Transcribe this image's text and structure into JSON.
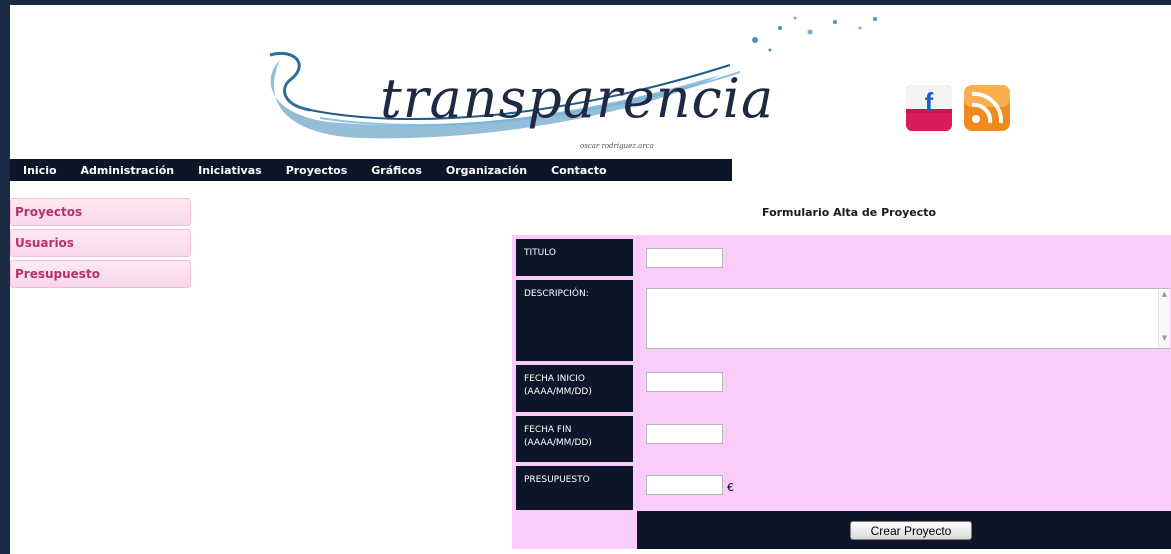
{
  "header": {
    "logo_text": "transparencia",
    "logo_tagline": "oscar rodriguez.arca",
    "social": [
      {
        "icon": "facebook-icon",
        "label": "f"
      },
      {
        "icon": "rss-icon"
      }
    ]
  },
  "nav": {
    "items": [
      {
        "label": "Inicio"
      },
      {
        "label": "Administración"
      },
      {
        "label": "Iniciativas"
      },
      {
        "label": "Proyectos"
      },
      {
        "label": "Gráficos"
      },
      {
        "label": "Organización"
      },
      {
        "label": "Contacto"
      }
    ]
  },
  "sidebar": {
    "items": [
      {
        "label": "Proyectos"
      },
      {
        "label": "Usuarios"
      },
      {
        "label": "Presupuesto"
      }
    ]
  },
  "form": {
    "title": "Formulario Alta de Proyecto",
    "fields": {
      "titulo": {
        "label": "TITULO",
        "value": ""
      },
      "descripcion": {
        "label": "DESCRIPCIÓN:",
        "value": ""
      },
      "fecha_inicio": {
        "label": "FECHA INICIO",
        "hint": "(AAAA/MM/DD)",
        "value": ""
      },
      "fecha_fin": {
        "label": "FECHA FIN",
        "hint": "(AAAA/MM/DD)",
        "value": ""
      },
      "presupuesto": {
        "label": "PRESUPUESTO",
        "value": "",
        "currency": "€"
      }
    },
    "submit_label": "Crear Proyecto"
  },
  "colors": {
    "page_background": "#1a2a44",
    "nav_background": "#0d1528",
    "form_background": "#f9ccf9",
    "menu_text": "#b8306a",
    "facebook": "#e8306a",
    "rss": "#f08a1c"
  }
}
